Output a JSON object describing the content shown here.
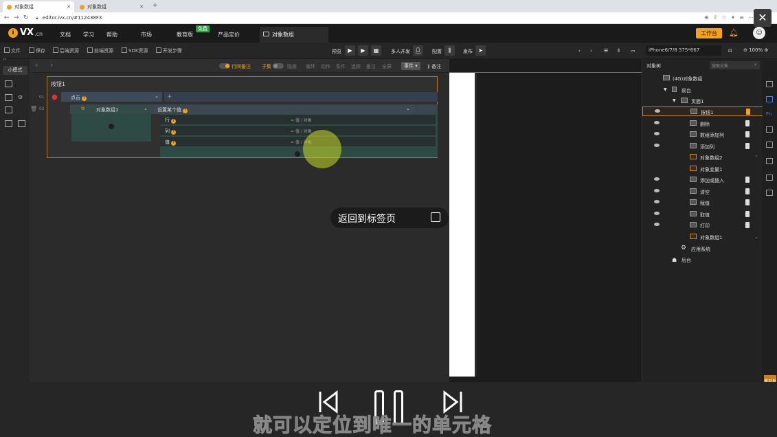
{
  "browser": {
    "tabs": [
      {
        "label": "对象数组",
        "active": true
      },
      {
        "label": "对象数组",
        "active": false
      }
    ],
    "url": "editor.ivx.cn/#112438F3"
  },
  "header": {
    "logo_text": "VX",
    "logo_suffix": ".cn",
    "menu": [
      "文档",
      "学习",
      "帮助",
      "市场",
      "教育版",
      "产品定价"
    ],
    "free_badge": "免费",
    "project_tab": "对象数组",
    "workbench_button": "工作台"
  },
  "toolbar": {
    "left_items": [
      "文件",
      "保存",
      "后端资源",
      "前端资源",
      "SDK资源",
      "开发步骤"
    ],
    "preview_label": "预览",
    "collab_label": "多人开发",
    "config_label": "配置",
    "publish_label": "发布",
    "device": "iPhone6/7/8 375*667",
    "zoom": "100%"
  },
  "left_rail": {
    "mode_label": "小模式"
  },
  "logic": {
    "bar_items": {
      "annotation_toggle": "行间备注",
      "sub_toggle": "子集",
      "hide": "隐层",
      "loop": "循环",
      "action": "动作",
      "condition": "条件",
      "trace": "追踪",
      "comment": "备注",
      "full": "全屏",
      "event": "事件",
      "note": "备注"
    },
    "frame_title": "按钮1",
    "rows": [
      "01",
      "02"
    ],
    "trigger": "点击",
    "object": "对象数组1",
    "action": "设置某个值",
    "params": [
      {
        "label": "行",
        "value": "值 / 对象"
      },
      {
        "label": "列",
        "value": "值 / 对象"
      },
      {
        "label": "值",
        "value": "值 / 对象"
      }
    ]
  },
  "tooltip": {
    "back_to_tab": "返回到标签页"
  },
  "object_tree": {
    "title": "对象树",
    "search_placeholder": "搜索对象",
    "nodes": [
      {
        "label": "(4G)对象数组",
        "indent": 0
      },
      {
        "label": "前台",
        "indent": 1
      },
      {
        "label": "页面1",
        "indent": 2
      },
      {
        "label": "按钮1",
        "indent": 3,
        "selected": true
      },
      {
        "label": "删除",
        "indent": 3
      },
      {
        "label": "数组添加列",
        "indent": 3
      },
      {
        "label": "添加列",
        "indent": 3
      },
      {
        "label": "对象数组2",
        "indent": 3,
        "var": true
      },
      {
        "label": "对象变量1",
        "indent": 3,
        "var": true
      },
      {
        "label": "添加或插入",
        "indent": 3
      },
      {
        "label": "清空",
        "indent": 3
      },
      {
        "label": "赋值",
        "indent": 3
      },
      {
        "label": "取值",
        "indent": 3
      },
      {
        "label": "打印",
        "indent": 3
      },
      {
        "label": "对象数组1",
        "indent": 3,
        "var": true
      },
      {
        "label": "应用系统",
        "indent": 2
      },
      {
        "label": "后台",
        "indent": 1
      }
    ]
  },
  "side_tab": "意见反馈",
  "subtitle": "就可以定位到唯一的单元格"
}
